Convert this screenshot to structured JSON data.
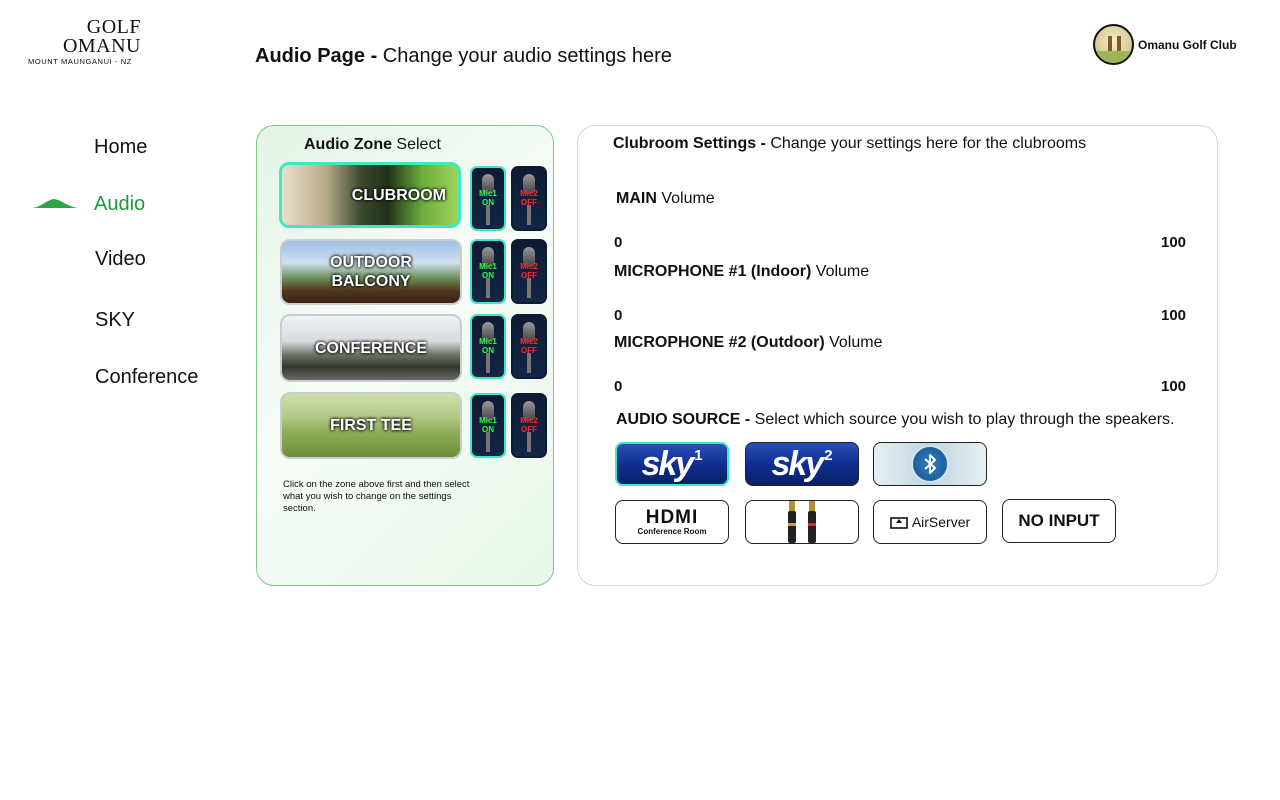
{
  "logo": {
    "line1": "GOLF",
    "line2": "OMANU",
    "line3": "MOUNT MAUNGANUI - NZ"
  },
  "header": {
    "title_bold": "Audio Page -",
    "title_rest": " Change your audio settings here"
  },
  "club": {
    "name": "Omanu Golf Club"
  },
  "nav": {
    "home": "Home",
    "audio": "Audio",
    "video": "Video",
    "sky": "SKY",
    "conference": "Conference",
    "active_color": "#1c9a3c"
  },
  "zones": {
    "title_bold": "Audio Zone",
    "title_rest": " Select",
    "items": [
      {
        "label": "CLUBROOM",
        "mic1": "Mic1\nON",
        "mic2": "Mic2\nOFF"
      },
      {
        "label": "OUTDOOR\nBALCONY",
        "mic1": "Mic1\nON",
        "mic2": "Mic2\nOFF"
      },
      {
        "label": "CONFERENCE",
        "mic1": "Mic1\nON",
        "mic2": "Mic2\nOFF"
      },
      {
        "label": "FIRST TEE",
        "mic1": "Mic1\nON",
        "mic2": "Mic2\nOFF"
      }
    ],
    "note": "Click on the zone above first and then select what you wish to change on the settings section.",
    "selected_color": "#3ee8c0"
  },
  "settings": {
    "title_bold": "Clubroom Settings -",
    "title_rest": " Change your settings here for the clubrooms",
    "main": {
      "label_bold": "MAIN",
      "label_rest": " Volume",
      "min": "0",
      "max": "100"
    },
    "mic1": {
      "label_bold": "MICROPHONE #1 (Indoor)",
      "label_rest": " Volume",
      "min": "0",
      "max": "100"
    },
    "mic2": {
      "label_bold": "MICROPHONE #2 (Outdoor)",
      "label_rest": " Volume",
      "min": "0",
      "max": "100"
    },
    "source": {
      "label_bold": "AUDIO SOURCE -",
      "label_rest": " Select which source you wish to play through the speakers.",
      "sky1": {
        "word": "sky",
        "num": "1"
      },
      "sky2": {
        "word": "sky",
        "num": "2"
      },
      "bluetooth_icon": "bluetooth-icon",
      "hdmi": {
        "line1": "HDMI",
        "line2": "Conference Room"
      },
      "rca_icon": "rca-cable-icon",
      "airserver": "AirServer",
      "no_input": "NO INPUT"
    }
  }
}
